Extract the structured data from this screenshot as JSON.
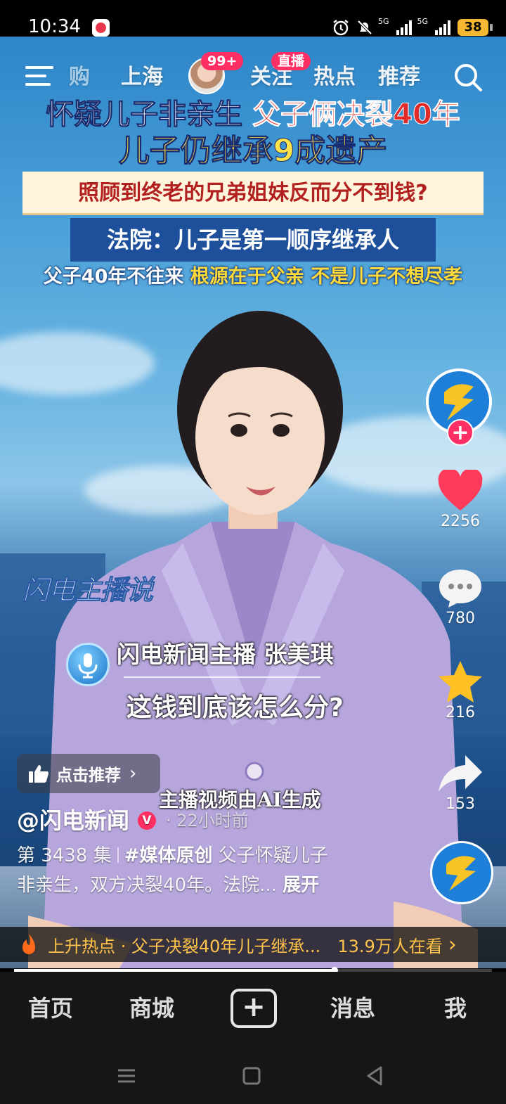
{
  "status_bar": {
    "time": "10:34",
    "battery": "38",
    "network_1": "5G",
    "network_2": "5G"
  },
  "top_nav": {
    "tabs": [
      "购",
      "上海",
      "关注",
      "热点",
      "推荐"
    ],
    "avatar_badge": "99+",
    "live_badge": "直播"
  },
  "headline": {
    "line1_white": "怀疑儿子非亲生",
    "line1_red": "父子俩决裂40年",
    "line2": "儿子仍继承9成遗产",
    "line3": "照顾到终老的兄弟姐妹反而分不到钱?",
    "line4": "法院：儿子是第一顺序继承人",
    "line5_white": "父子40年不往来",
    "line5_yellow": "根源在于父亲",
    "line5_white2": "不是儿子不想尽孝"
  },
  "overlay": {
    "brand_logo": "闪电主播说",
    "anchor_caption": "闪电新闻主播 张美琪",
    "subtitle": "这钱到底该怎么分?",
    "ai_note": "主播视频由AI生成"
  },
  "actions": {
    "likes": "2256",
    "comments": "780",
    "favorites": "216",
    "shares": "153"
  },
  "recommend": {
    "label": "点击推荐"
  },
  "post": {
    "author": "@闪电新闻",
    "time_ago": "· 22小时前",
    "episode": "第 3438 集",
    "tag": "#媒体原创",
    "desc_line1": "父子怀疑儿子",
    "desc_line2": "非亲生，双方决裂40年。法院...",
    "expand": "展开"
  },
  "hot_bar": {
    "text": "上升热点 · 父子决裂40年儿子继承...",
    "viewers": "13.9万人在看"
  },
  "video_progress": 0.67,
  "bottom_nav": {
    "home": "首页",
    "mall": "商城",
    "messages": "消息",
    "me": "我"
  },
  "colors": {
    "accent": "#ff2e63",
    "hot": "#ffc34a",
    "headline_yellow": "#ffe24a"
  }
}
